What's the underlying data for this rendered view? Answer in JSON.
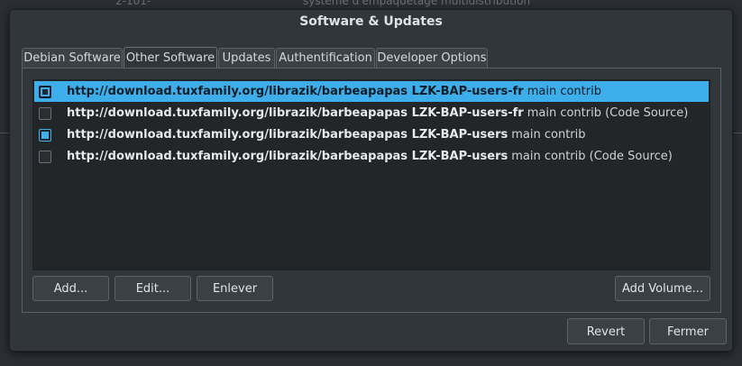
{
  "backdrop": {
    "text_left": "2-101-",
    "text_right": "système d'empaquetage multidistribution"
  },
  "window": {
    "title": "Software & Updates"
  },
  "tabs": [
    {
      "label": "Debian Software",
      "active": false
    },
    {
      "label": "Other Software",
      "active": true
    },
    {
      "label": "Updates",
      "active": false
    },
    {
      "label": "Authentification",
      "active": false
    },
    {
      "label": "Developer Options",
      "active": false
    }
  ],
  "sources": [
    {
      "url": "http://download.tuxfamily.org/librazik/barbeapapas LZK-BAP-users-fr",
      "options": "main contrib",
      "checked": true,
      "selected": true
    },
    {
      "url": "http://download.tuxfamily.org/librazik/barbeapapas LZK-BAP-users-fr",
      "options": "main contrib (Code Source)",
      "checked": false,
      "selected": false
    },
    {
      "url": "http://download.tuxfamily.org/librazik/barbeapapas LZK-BAP-users",
      "options": "main contrib",
      "checked": true,
      "selected": false
    },
    {
      "url": "http://download.tuxfamily.org/librazik/barbeapapas LZK-BAP-users",
      "options": "main contrib (Code Source)",
      "checked": false,
      "selected": false
    }
  ],
  "panel_buttons": {
    "add": "Add...",
    "edit": "Edit...",
    "remove": "Enlever",
    "add_volume": "Add Volume..."
  },
  "dialog_buttons": {
    "revert": "Revert",
    "close": "Fermer"
  },
  "colors": {
    "accent": "#3daee9",
    "window_bg": "#31363b",
    "list_bg": "#232629"
  }
}
